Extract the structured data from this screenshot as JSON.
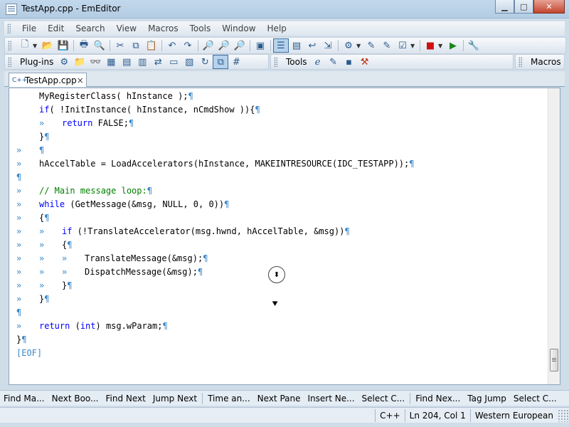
{
  "window": {
    "title": "TestApp.cpp - EmEditor",
    "minimize": "▁",
    "maximize": "□",
    "close": "✕"
  },
  "menu": [
    "File",
    "Edit",
    "Search",
    "View",
    "Macros",
    "Tools",
    "Window",
    "Help"
  ],
  "toolbar2": {
    "plugins_label": "Plug-ins",
    "tools_label": "Tools",
    "macros_label": "Macros"
  },
  "tab": {
    "name": "TestApp.cpp",
    "icon": "C++",
    "close": "×"
  },
  "code_lines": [
    {
      "indent": 1,
      "text": "MyRegisterClass( hInstance );",
      "eol": "¶"
    },
    {
      "indent": 1,
      "text": "if( !InitInstance( hInstance, nCmdShow )){",
      "eol": "¶"
    },
    {
      "indent": 1,
      "tabs": 1,
      "text": "return FALSE;",
      "eol": "¶"
    },
    {
      "indent": 1,
      "text": "}",
      "eol": "¶"
    },
    {
      "tabs": 1,
      "text": "",
      "eol": "¶"
    },
    {
      "tabs": 1,
      "text": "hAccelTable = LoadAccelerators(hInstance, MAKEINTRESOURCE(IDC_TESTAPP));",
      "eol": "¶"
    },
    {
      "text": "",
      "eol": "¶"
    },
    {
      "tabs": 1,
      "text": "// Main message loop:",
      "eol": "¶"
    },
    {
      "tabs": 1,
      "text": "while (GetMessage(&msg, NULL, 0, 0))",
      "eol": "¶"
    },
    {
      "tabs": 1,
      "text": "{",
      "eol": "¶"
    },
    {
      "tabs": 2,
      "text": "if (!TranslateAccelerator(msg.hwnd, hAccelTable, &msg))",
      "eol": "¶"
    },
    {
      "tabs": 2,
      "text": "{",
      "eol": "¶"
    },
    {
      "tabs": 3,
      "text": "TranslateMessage(&msg);",
      "eol": "¶"
    },
    {
      "tabs": 3,
      "text": "DispatchMessage(&msg);",
      "eol": "¶"
    },
    {
      "tabs": 2,
      "text": "}",
      "eol": "¶"
    },
    {
      "tabs": 1,
      "text": "}",
      "eol": "¶"
    },
    {
      "text": "",
      "eol": "¶"
    },
    {
      "tabs": 1,
      "text": "return (int) msg.wParam;",
      "eol": "¶"
    },
    {
      "text": "}",
      "eol": "¶"
    },
    {
      "text": "[EOF]",
      "eof": true
    }
  ],
  "tab_marker": "»",
  "function_keys": [
    "Find Ma...",
    "Next Boo...",
    "Find Next",
    "Jump Next",
    "Time an...",
    "Next Pane",
    "Insert Ne...",
    "Select C...",
    "Find Nex...",
    "Tag Jump",
    "Select C..."
  ],
  "status": {
    "language": "C++",
    "position": "Ln 204, Col 1",
    "encoding": "Western European"
  },
  "colors": {
    "keyword": "#0000ff",
    "comment": "#008000",
    "marker": "#3a88c8"
  }
}
